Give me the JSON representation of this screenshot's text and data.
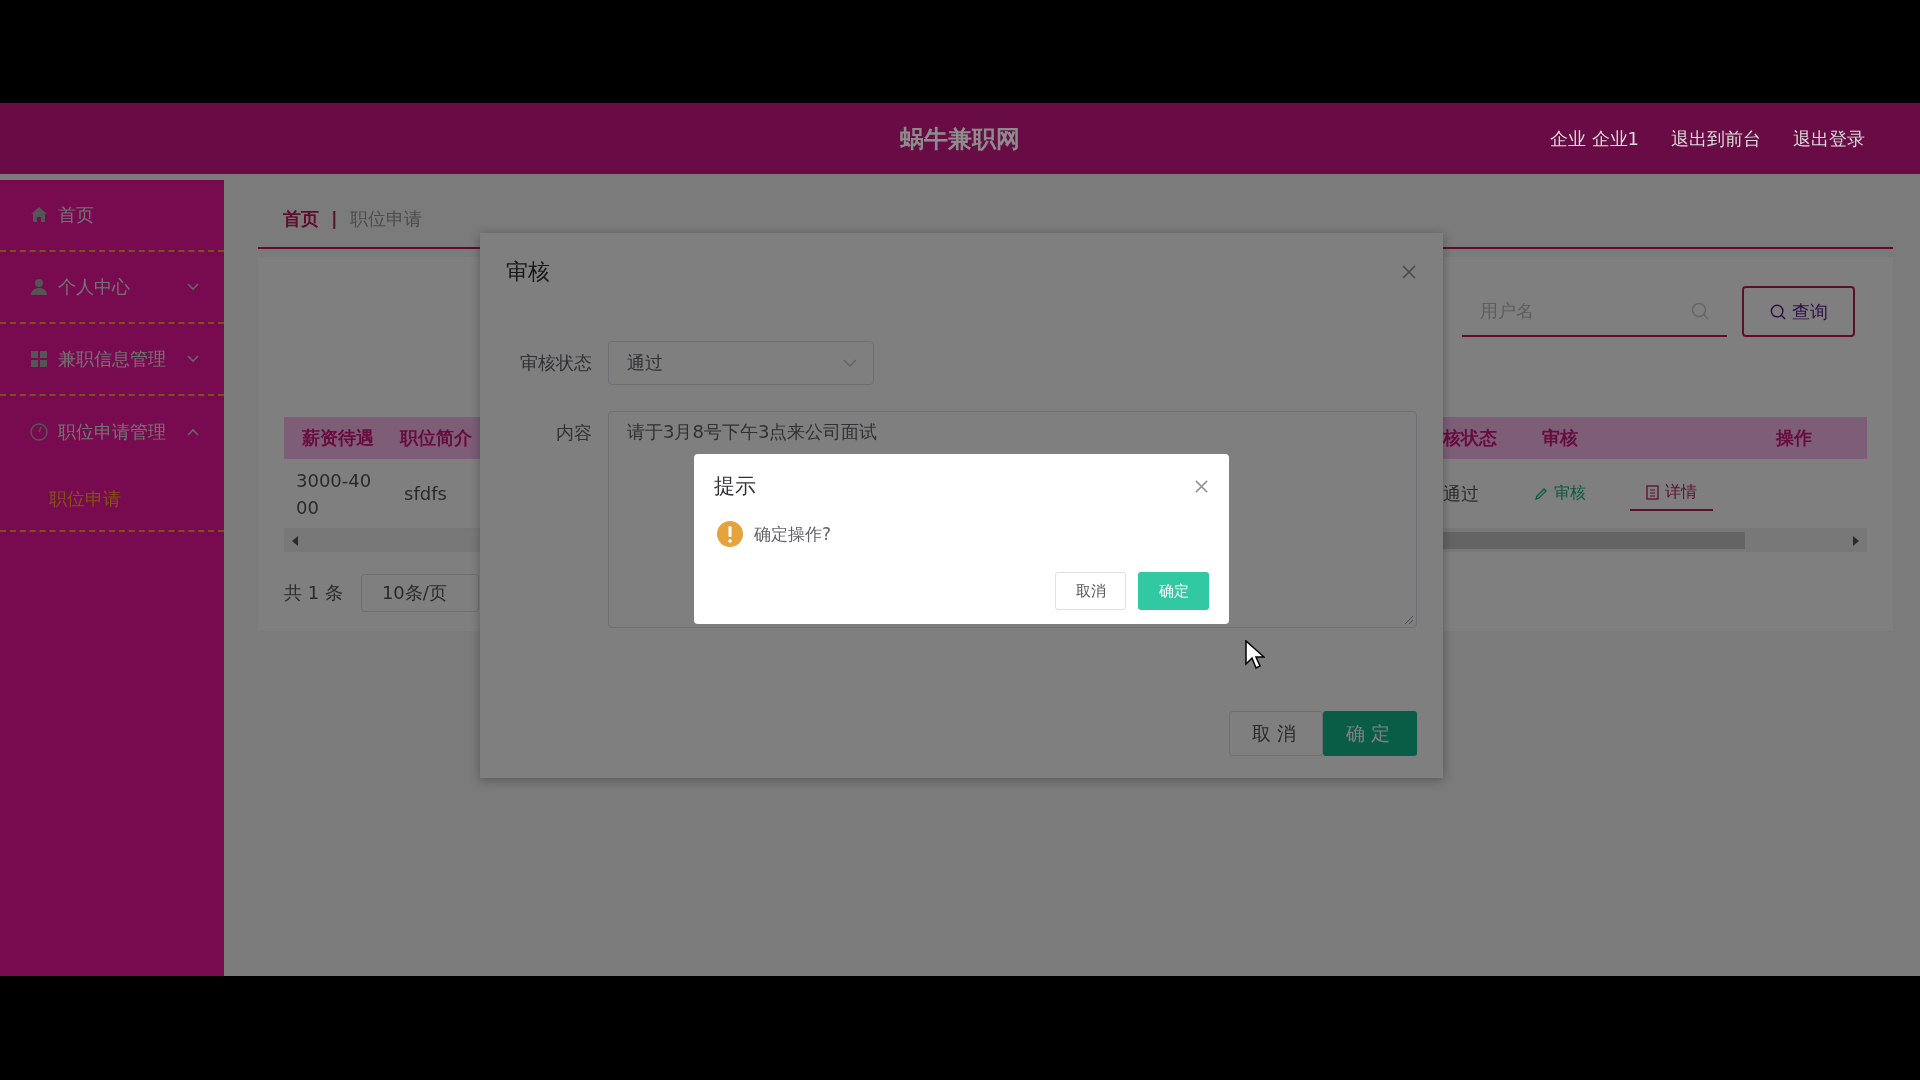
{
  "header": {
    "title": "蜗牛兼职网",
    "links": [
      "企业 企业1",
      "退出到前台",
      "退出登录"
    ]
  },
  "sidebar": {
    "items": [
      {
        "label": "首页",
        "kind": "link"
      },
      {
        "label": "个人中心",
        "kind": "submenu",
        "expanded": false
      },
      {
        "label": "兼职信息管理",
        "kind": "submenu",
        "expanded": false
      },
      {
        "label": "职位申请管理",
        "kind": "submenu",
        "expanded": true,
        "children": [
          {
            "label": "职位申请",
            "selected": true
          }
        ]
      }
    ]
  },
  "breadcrumb": {
    "items": [
      "首页",
      "职位申请"
    ],
    "separator": "|"
  },
  "search": {
    "placeholder": "用户名",
    "button": "查询"
  },
  "table": {
    "columns": [
      "薪资待遇",
      "职位简介",
      "核状态",
      "审核",
      "操作"
    ],
    "rows": [
      {
        "cells": [
          "3000-4000",
          "sfdfs",
          "通过"
        ],
        "actions": [
          "审核",
          "详情"
        ]
      }
    ]
  },
  "pagination": {
    "total": "共 1 条",
    "page_size": "10条/页"
  },
  "audit_dialog": {
    "title": "审核",
    "fields": [
      {
        "label": "审核状态",
        "kind": "select",
        "value": "通过"
      },
      {
        "label": "内容",
        "kind": "textarea",
        "value": "请于3月8号下午3点来公司面试"
      }
    ],
    "buttons": [
      {
        "label": "取消",
        "primary": false
      },
      {
        "label": "确定",
        "primary": true
      }
    ]
  },
  "confirm_dialog": {
    "title": "提示",
    "message": "确定操作?",
    "buttons": [
      {
        "label": "取消",
        "primary": false
      },
      {
        "label": "确定",
        "primary": true
      }
    ]
  }
}
